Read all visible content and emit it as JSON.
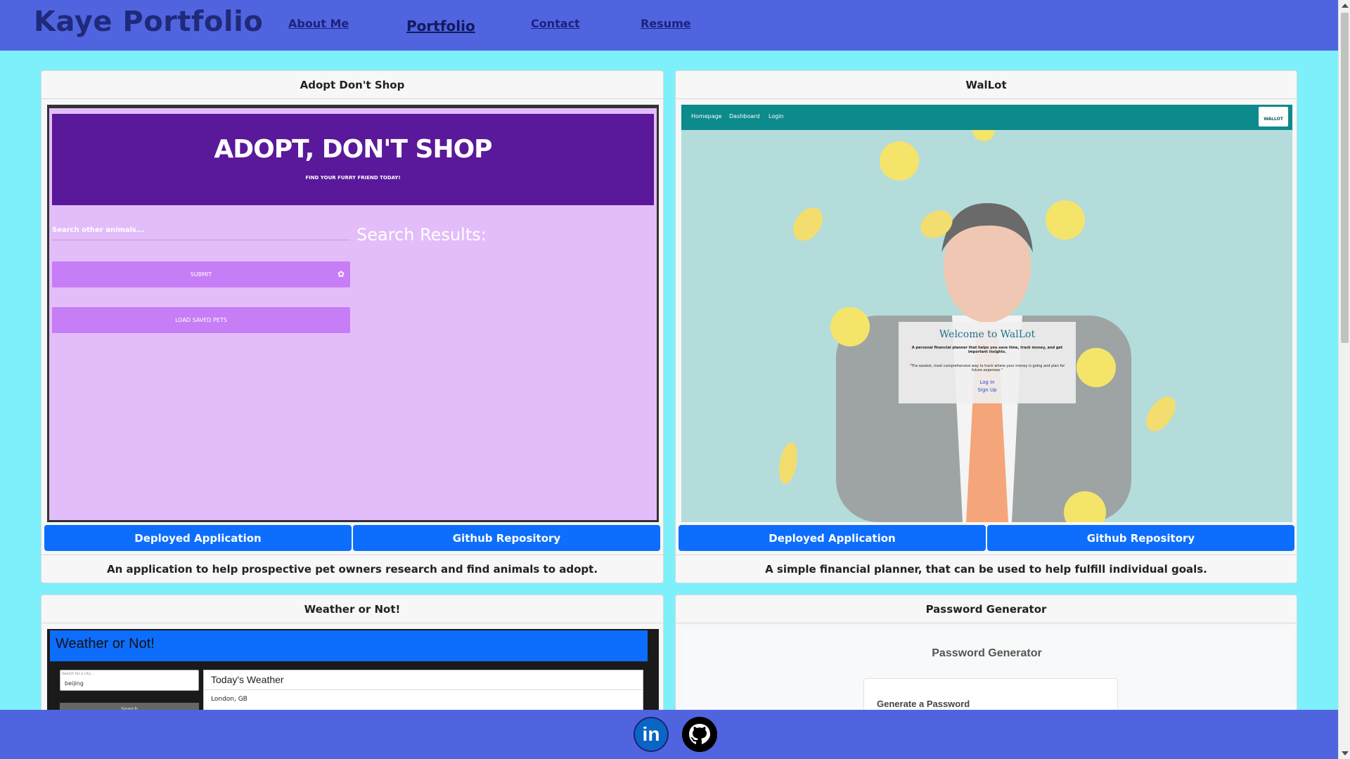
{
  "brand": "Kaye Portfolio",
  "nav": {
    "links": [
      {
        "label": "About Me"
      },
      {
        "label": "Portfolio"
      },
      {
        "label": "Contact"
      },
      {
        "label": "Resume"
      }
    ]
  },
  "projects": [
    {
      "title": "Adopt Don't Shop",
      "deploy_label": "Deployed Application",
      "repo_label": "Github Repository",
      "description": "An application to help prospective pet owners research and find animals to adopt.",
      "screenshot": {
        "banner_title": "ADOPT, DON'T SHOP",
        "banner_subtitle": "FIND YOUR FURRY FRIEND TODAY!",
        "search_placeholder": "Search other animals...",
        "results_heading": "Search Results:",
        "submit_label": "SUBMIT",
        "load_label": "LOAD SAVED PETS"
      }
    },
    {
      "title": "WalLot",
      "deploy_label": "Deployed Application",
      "repo_label": "Github Repository",
      "description": "A simple financial planner, that can be used to help fulfill individual goals.",
      "screenshot": {
        "nav_links": [
          "Homepage",
          "Dashboard",
          "Login"
        ],
        "logo_text": "WALLOT",
        "welcome": "Welcome to WalLot",
        "tagline": "A personal financial planner that helps you save time, track money, and get important insights.",
        "quote": "\"The easiest, most comprehensive way to track where your money is going and plan for future expenses.\"",
        "login": "Log In",
        "signup": "Sign Up"
      }
    },
    {
      "title": "Weather or Not!",
      "screenshot": {
        "app_title": "Weather or Not!",
        "search_placeholder": "Search for a city...",
        "search_value": "beijing",
        "search_button": "Search",
        "panel_heading": "Today's Weather",
        "city": "London, GB"
      }
    },
    {
      "title": "Password Generator",
      "screenshot": {
        "app_title": "Password Generator",
        "card_heading": "Generate a Password"
      }
    }
  ],
  "footer": {
    "linkedin_glyph": "in",
    "icons": [
      "linkedin-icon",
      "github-icon"
    ]
  },
  "colors": {
    "background": "#7ef0fb",
    "nav": "#5164e0",
    "button": "#0d6efd",
    "adopt_banner": "#5a189a",
    "adopt_bg": "#e3bdf9",
    "wallot_nav": "#0d8a8c"
  }
}
